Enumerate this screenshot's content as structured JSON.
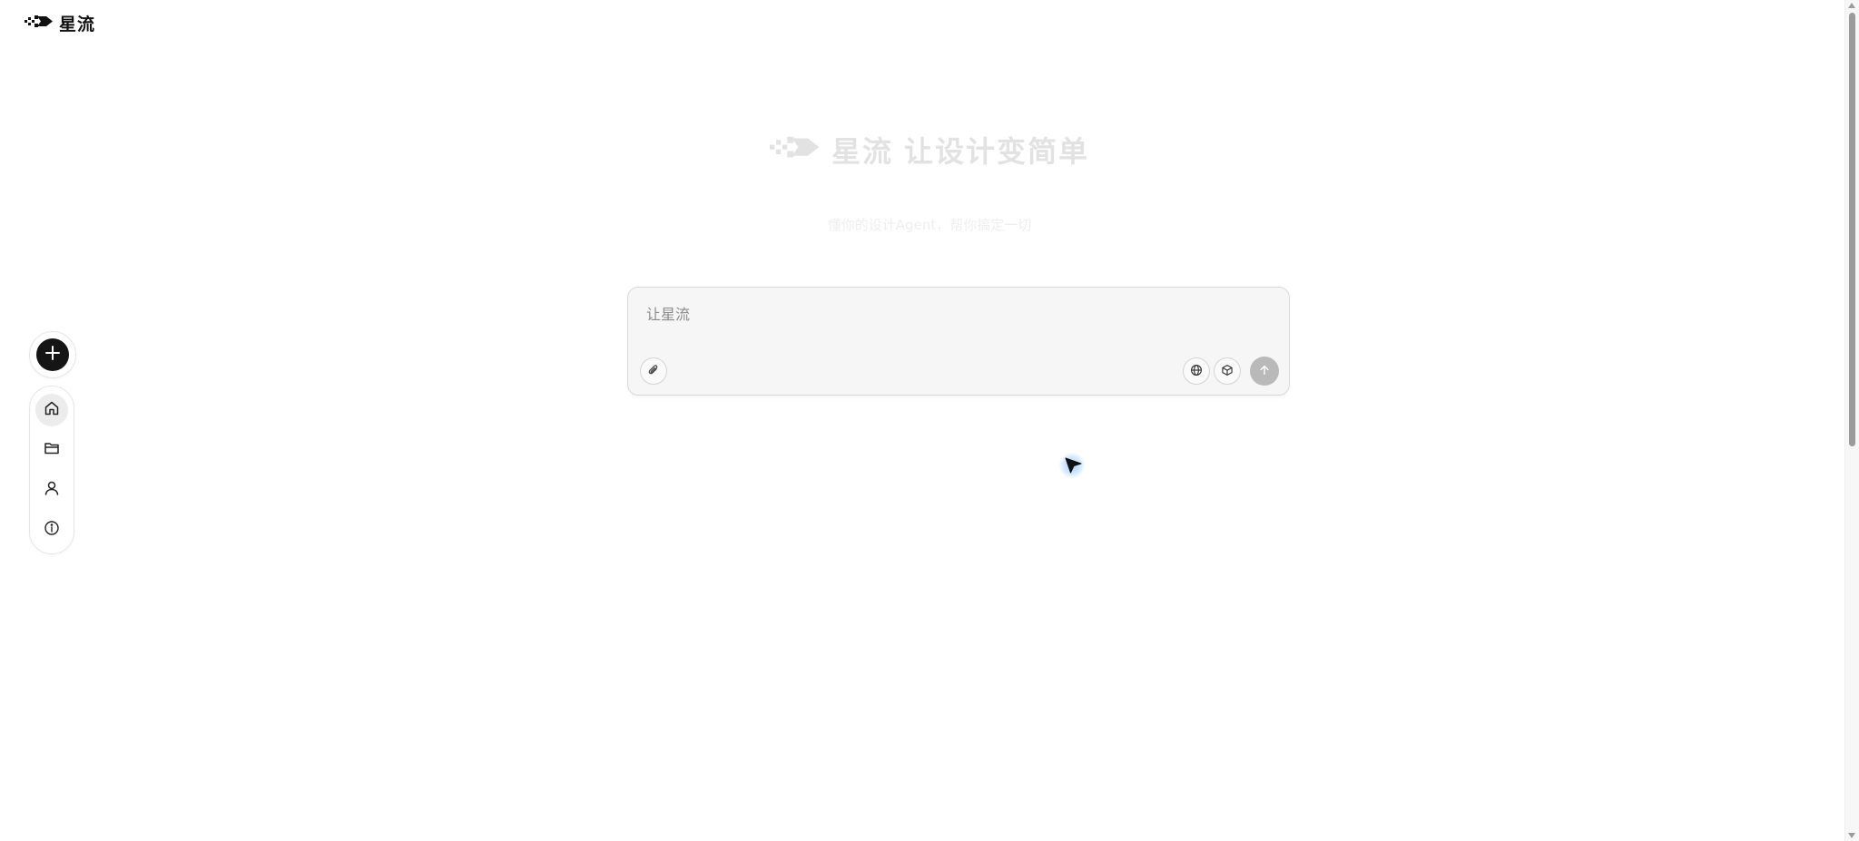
{
  "brand": {
    "name": "星流",
    "logo_icon": "xingliu-logo-icon"
  },
  "sidebar": {
    "new_button_icon": "plus-icon",
    "items": [
      {
        "id": "home",
        "icon": "home-icon",
        "active": true
      },
      {
        "id": "folder",
        "icon": "folder-icon",
        "active": false
      },
      {
        "id": "profile",
        "icon": "user-icon",
        "active": false
      },
      {
        "id": "info",
        "icon": "info-icon",
        "active": false
      }
    ]
  },
  "hero": {
    "brand": "星流",
    "tagline": "让设计变简单",
    "subtitle": "懂你的设计Agent，帮你搞定一切"
  },
  "composer": {
    "placeholder": "让星流",
    "value": "",
    "attach_icon": "paperclip-icon",
    "web_icon": "globe-icon",
    "model_icon": "cube-icon",
    "send_icon": "arrow-up-icon"
  },
  "colors": {
    "accent_dark": "#151515",
    "hero_text": "#e2e2e2",
    "send_disabled": "#b9b9b9",
    "composer_bg": "#f6f6f6"
  }
}
